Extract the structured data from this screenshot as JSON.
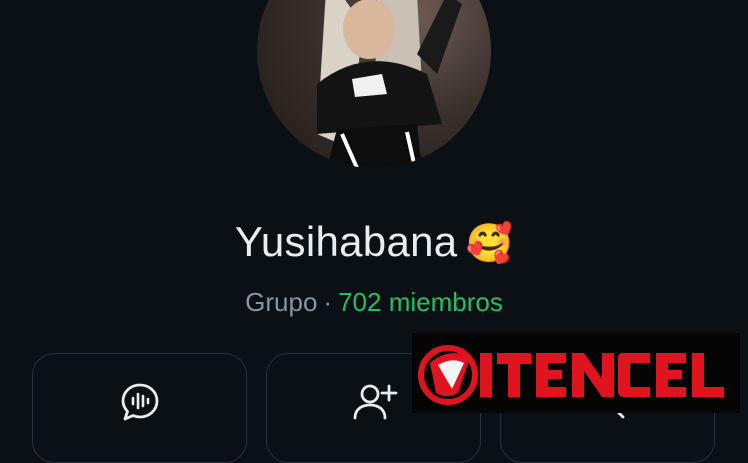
{
  "profile": {
    "name": "Yusihabana",
    "emoji": "🥰",
    "type_label": "Grupo",
    "separator": "·",
    "members_label": "702 miembros"
  },
  "actions": [
    {
      "icon": "voice-chat-icon"
    },
    {
      "icon": "add-member-icon"
    },
    {
      "icon": "search-icon"
    }
  ],
  "watermark": {
    "text": "ITENCEL"
  },
  "colors": {
    "background": "#0b1014",
    "primary_text": "#e9edef",
    "secondary_text": "#8696a0",
    "accent_green": "#21c063",
    "watermark_red": "#e0141e"
  }
}
